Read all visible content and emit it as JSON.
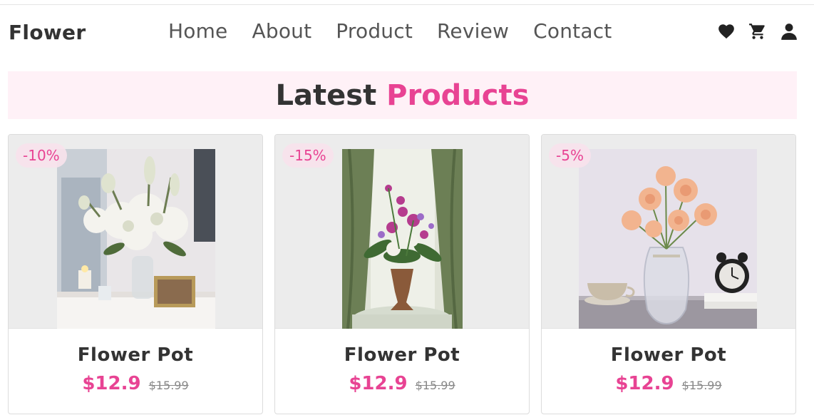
{
  "header": {
    "logo": "Flower",
    "nav": [
      "Home",
      "About",
      "Product",
      "Review",
      "Contact"
    ],
    "icons": [
      "heart-icon",
      "cart-icon",
      "user-icon"
    ]
  },
  "banner": {
    "title_part1": "Latest",
    "title_part2": "Products"
  },
  "colors": {
    "accent": "#e84393",
    "banner_bg": "#fff1f7",
    "card_img_bg": "#ececec"
  },
  "products": [
    {
      "discount": "-10%",
      "name": "Flower Pot",
      "price": "$12.9",
      "old_price": "$15.99"
    },
    {
      "discount": "-15%",
      "name": "Flower Pot",
      "price": "$12.9",
      "old_price": "$15.99"
    },
    {
      "discount": "-5%",
      "name": "Flower Pot",
      "price": "$12.9",
      "old_price": "$15.99"
    }
  ]
}
